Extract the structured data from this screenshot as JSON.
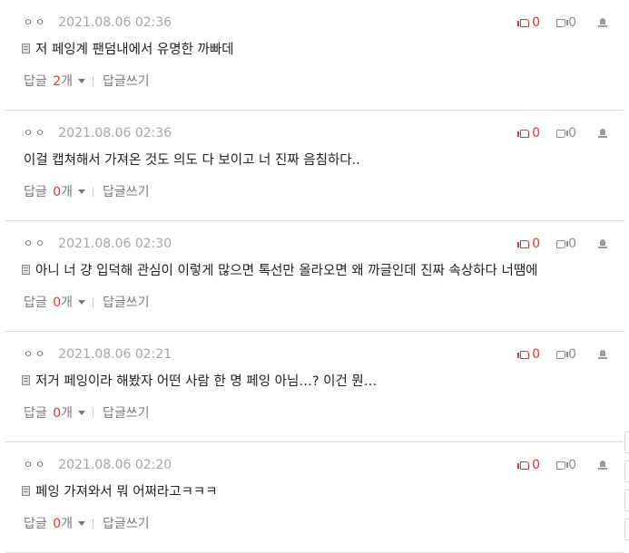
{
  "labels": {
    "reply": "답글",
    "unit": "개",
    "write_reply": "답글쓰기",
    "dots": "ㅇㅇ"
  },
  "comments": [
    {
      "author": "ㅇㅇ",
      "date": "2021.08.06 02:36",
      "text": "저 페잉계 팬덤내에서 유명한 까빠데",
      "has_doc_icon": true,
      "likes": "0",
      "dislikes": "0",
      "reply_count": "2"
    },
    {
      "author": "ㅇㅇ",
      "date": "2021.08.06 02:36",
      "text": "이걸 캡쳐해서 가져온 것도 의도 다 보이고 너 진짜 음침하다..",
      "has_doc_icon": false,
      "likes": "0",
      "dislikes": "0",
      "reply_count": "0"
    },
    {
      "author": "ㅇㅇ",
      "date": "2021.08.06 02:30",
      "text": "아니 너 걍 입덕해 관심이 이렇게 많으면 톡선만 올라오면 왜 까글인데 진짜 속상하다 너땜에",
      "has_doc_icon": true,
      "likes": "0",
      "dislikes": "0",
      "reply_count": "0"
    },
    {
      "author": "ㅇㅇ",
      "date": "2021.08.06 02:21",
      "text": "저거 페잉이라 해봤자 어떤 사람 한 명 페잉 아님…? 이건 뭔…",
      "has_doc_icon": true,
      "likes": "0",
      "dislikes": "0",
      "reply_count": "0"
    },
    {
      "author": "ㅇㅇ",
      "date": "2021.08.06 02:20",
      "text": "페잉 가져와서 뭐 어쩌라고ㅋㅋㅋ",
      "has_doc_icon": true,
      "likes": "0",
      "dislikes": "0",
      "reply_count": "0"
    }
  ]
}
